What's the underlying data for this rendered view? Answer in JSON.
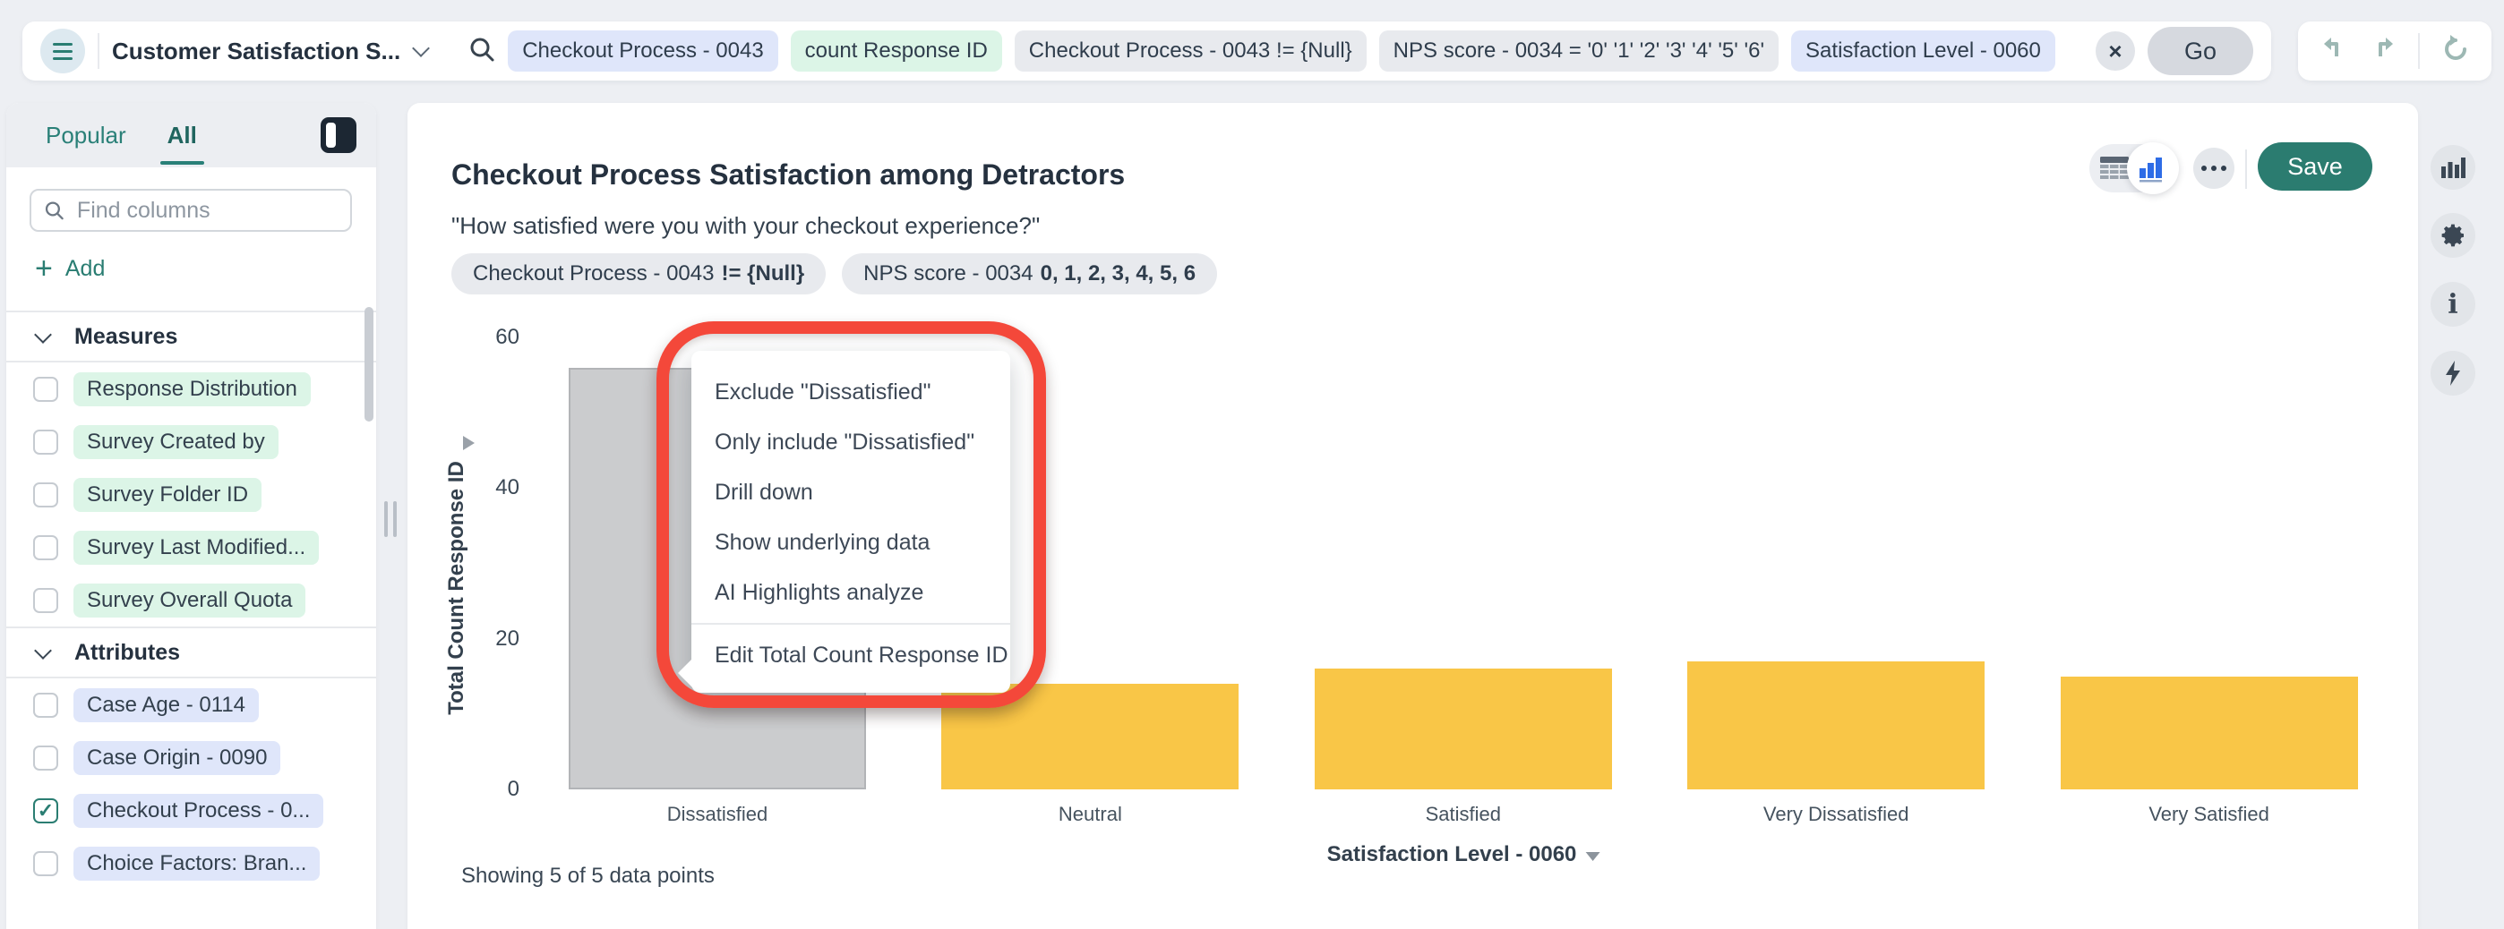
{
  "topbar": {
    "workspace_title": "Customer Satisfaction S...",
    "search_pills": [
      {
        "text": "Checkout Process - 0043",
        "color": "blue"
      },
      {
        "text": "count Response ID",
        "color": "green"
      },
      {
        "text": "Checkout Process - 0043 != {Null}",
        "color": "gray"
      },
      {
        "text": "NPS score - 0034 = '0' '1' '2' '3' '4' '5' '6'",
        "color": "gray"
      },
      {
        "text": "Satisfaction Level - 0060",
        "color": "blue"
      }
    ],
    "clear_label": "×",
    "go_label": "Go"
  },
  "sidebar": {
    "tabs": [
      {
        "label": "Popular",
        "active": false
      },
      {
        "label": "All",
        "active": true
      }
    ],
    "find_placeholder": "Find columns",
    "add_label": "Add",
    "sections": [
      {
        "title": "Measures",
        "pill_color": "green",
        "items": [
          {
            "label": "Response Distribution",
            "checked": false
          },
          {
            "label": "Survey Created by",
            "checked": false
          },
          {
            "label": "Survey Folder ID",
            "checked": false
          },
          {
            "label": "Survey Last Modified...",
            "checked": false
          },
          {
            "label": "Survey Overall Quota",
            "checked": false
          }
        ]
      },
      {
        "title": "Attributes",
        "pill_color": "blue",
        "items": [
          {
            "label": "Case Age - 0114",
            "checked": false
          },
          {
            "label": "Case Origin - 0090",
            "checked": false
          },
          {
            "label": "Checkout Process - 0...",
            "checked": true
          },
          {
            "label": "Choice Factors: Bran...",
            "checked": false
          }
        ]
      }
    ]
  },
  "main": {
    "title": "Checkout Process Satisfaction among Detractors",
    "subtitle": "\"How satisfied were you with your checkout experience?\"",
    "filter_chips": [
      {
        "label": "Checkout Process - 0043",
        "value": "!= {Null}"
      },
      {
        "label": "NPS score - 0034",
        "value": "0, 1, 2, 3, 4, 5, 6"
      }
    ],
    "save_label": "Save",
    "footer": "Showing 5 of 5 data points"
  },
  "context_menu": {
    "items": [
      "Exclude \"Dissatisfied\"",
      "Only include \"Dissatisfied\"",
      "Drill down",
      "Show underlying data",
      "AI Highlights analyze",
      "Edit Total Count Response ID"
    ],
    "divider_before": 5
  },
  "chart_data": {
    "type": "bar",
    "title": "Checkout Process Satisfaction among Detractors",
    "subtitle": "\"How satisfied were you with your checkout experience?\"",
    "categories": [
      "Dissatisfied",
      "Neutral",
      "Satisfied",
      "Very Dissatisfied",
      "Very Satisfied"
    ],
    "values": [
      56,
      14,
      16,
      17,
      15
    ],
    "selected_category": "Dissatisfied",
    "xlabel": "Satisfaction Level - 0060",
    "ylabel": "Total Count Response ID",
    "ylim": [
      0,
      60
    ],
    "yticks": [
      0,
      20,
      40,
      60
    ],
    "grid": false,
    "legend": false,
    "bar_color": "#F9C647",
    "selected_bar_color": "#CBCCCE"
  },
  "icons": {
    "hamburger": "menu-icon",
    "search": "magnifier",
    "undo": "arrow-undo",
    "redo": "arrow-redo",
    "refresh": "arrow-refresh",
    "panel_toggle": "collapse-sidebar",
    "table_view": "table-grid",
    "chart_view": "bar-chart",
    "more": "ellipsis",
    "rail": [
      "bar-chart",
      "gear",
      "info",
      "lightning-bolt"
    ]
  },
  "colors": {
    "accent_teal": "#2A7D72",
    "save_green": "#2B7C70",
    "bar_yellow": "#F9C647",
    "selected_bar_gray": "#CBCCCE",
    "annotation_red": "#F4483A",
    "pill_blue": "#DFE6FA",
    "pill_green": "#DCF5E7",
    "pill_gray": "#E8EAEE"
  }
}
